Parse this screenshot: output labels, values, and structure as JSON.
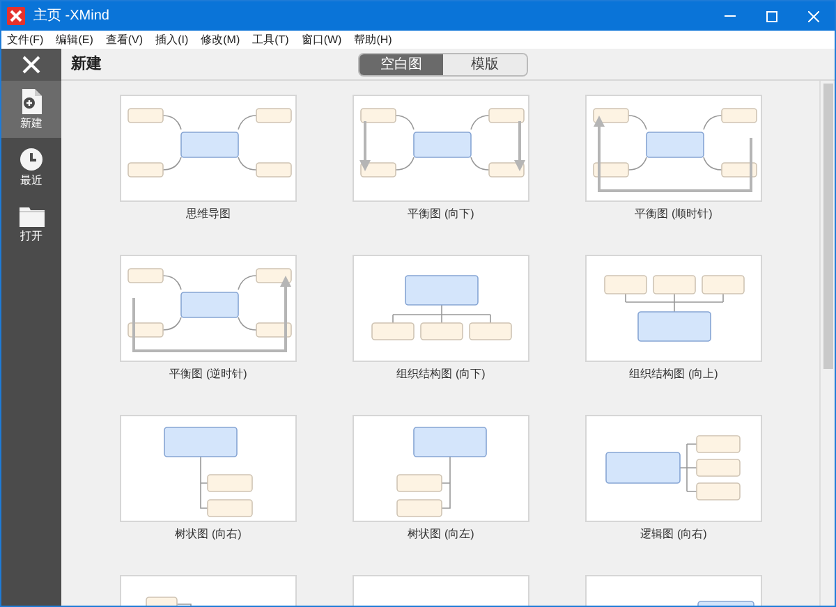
{
  "window": {
    "title": "主页 -XMind"
  },
  "menu": [
    "文件(F)",
    "编辑(E)",
    "查看(V)",
    "插入(I)",
    "修改(M)",
    "工具(T)",
    "窗口(W)",
    "帮助(H)"
  ],
  "sidebar": {
    "items": [
      {
        "kind": "new",
        "label": "新建",
        "selected": true
      },
      {
        "kind": "recent",
        "label": "最近",
        "selected": false
      },
      {
        "kind": "open",
        "label": "打开",
        "selected": false
      }
    ]
  },
  "header": {
    "title": "新建",
    "tabs": [
      {
        "label": "空白图",
        "selected": true
      },
      {
        "label": "模版",
        "selected": false
      }
    ]
  },
  "templates": [
    {
      "kind": "mindmap",
      "label": "思维导图"
    },
    {
      "kind": "balance-down",
      "label": "平衡图 (向下)"
    },
    {
      "kind": "balance-cw",
      "label": "平衡图 (顺时针)"
    },
    {
      "kind": "balance-ccw",
      "label": "平衡图 (逆时针)"
    },
    {
      "kind": "org-down",
      "label": "组织结构图 (向下)"
    },
    {
      "kind": "org-up",
      "label": "组织结构图 (向上)"
    },
    {
      "kind": "tree-right",
      "label": "树状图 (向右)"
    },
    {
      "kind": "tree-left",
      "label": "树状图 (向左)"
    },
    {
      "kind": "logic-right",
      "label": "逻辑图 (向右)"
    },
    {
      "kind": "partial-topic"
    },
    {
      "kind": "partial-empty"
    },
    {
      "kind": "partial-central"
    }
  ]
}
